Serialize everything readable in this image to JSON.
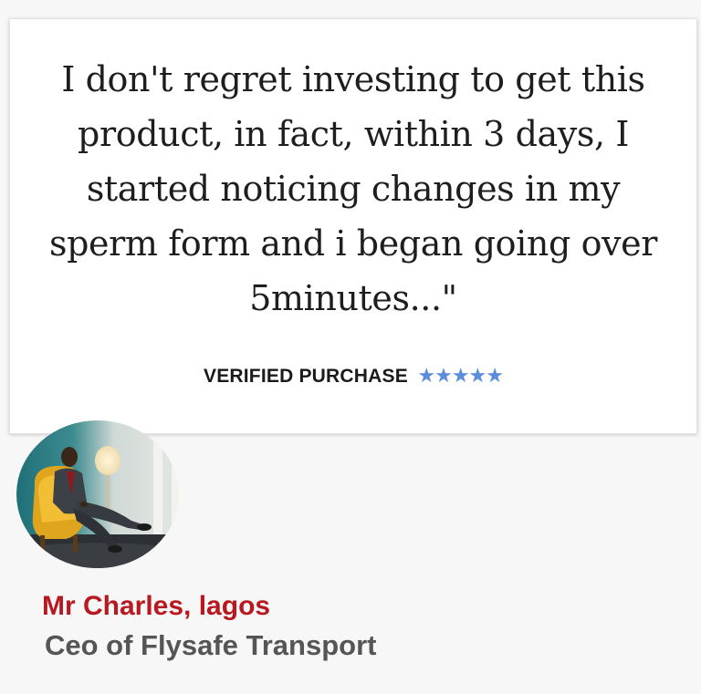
{
  "testimonial": {
    "quote": "I don't regret investing to get this product, in fact, within 3 days, I started noticing changes in my sperm form and i began going over 5minutes...\"",
    "verified_label": "VERIFIED PURCHASE",
    "stars": "★★★★★",
    "rating": 5,
    "star_color": "#5b8ddb"
  },
  "author": {
    "avatar_icon": "person-in-chair-photo",
    "name": "Mr Charles, lagos",
    "role": "Ceo of Flysafe Transport",
    "name_color": "#b81820"
  }
}
